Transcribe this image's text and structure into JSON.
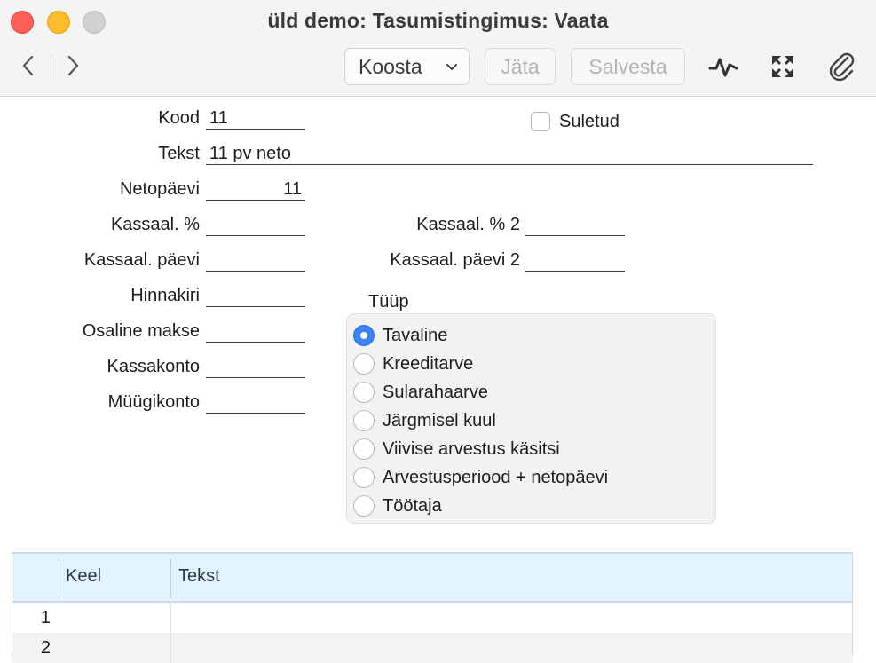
{
  "window": {
    "title": "üld demo: Tasumistingimus: Vaata"
  },
  "toolbar": {
    "koosta_label": "Koosta",
    "jata_label": "Jäta",
    "salvesta_label": "Salvesta",
    "icons": [
      "chevron-left-icon",
      "chevron-right-icon",
      "chevron-down-icon",
      "activity-icon",
      "fullscreen-icon",
      "paperclip-icon"
    ],
    "disabled_color": "#b4b4b4"
  },
  "form": {
    "kood": {
      "label": "Kood",
      "value": "11"
    },
    "tekst": {
      "label": "Tekst",
      "value": "11 pv neto"
    },
    "netopaevi": {
      "label": "Netopäevi",
      "value": "11"
    },
    "kassaal_pct": {
      "label": "Kassaal. %",
      "value": ""
    },
    "kassaal_paevi": {
      "label": "Kassaal. päevi",
      "value": ""
    },
    "hinnakiri": {
      "label": "Hinnakiri",
      "value": ""
    },
    "osaline_makse": {
      "label": "Osaline makse",
      "value": ""
    },
    "kassakonto": {
      "label": "Kassakonto",
      "value": ""
    },
    "muugikonto": {
      "label": "Müügikonto",
      "value": ""
    },
    "kassaal_pct2": {
      "label": "Kassaal. % 2",
      "value": ""
    },
    "kassaal_paevi2": {
      "label": "Kassaal. päevi 2",
      "value": ""
    },
    "suletud": {
      "label": "Suletud",
      "checked": false
    }
  },
  "tyyp": {
    "label": "Tüüp",
    "selected": 0,
    "accent": "#3b82f6",
    "options": [
      "Tavaline",
      "Kreeditarve",
      "Sularahaarve",
      "Järgmisel kuul",
      "Viivise arvestus käsitsi",
      "Arvestusperiood + netopäevi",
      "Töötaja"
    ]
  },
  "grid": {
    "headers": [
      "Keel",
      "Tekst"
    ],
    "header_bg": "#e3f3fb",
    "rows": [
      {
        "num": "1",
        "keel": "",
        "tekst": ""
      },
      {
        "num": "2",
        "keel": "",
        "tekst": ""
      }
    ]
  }
}
